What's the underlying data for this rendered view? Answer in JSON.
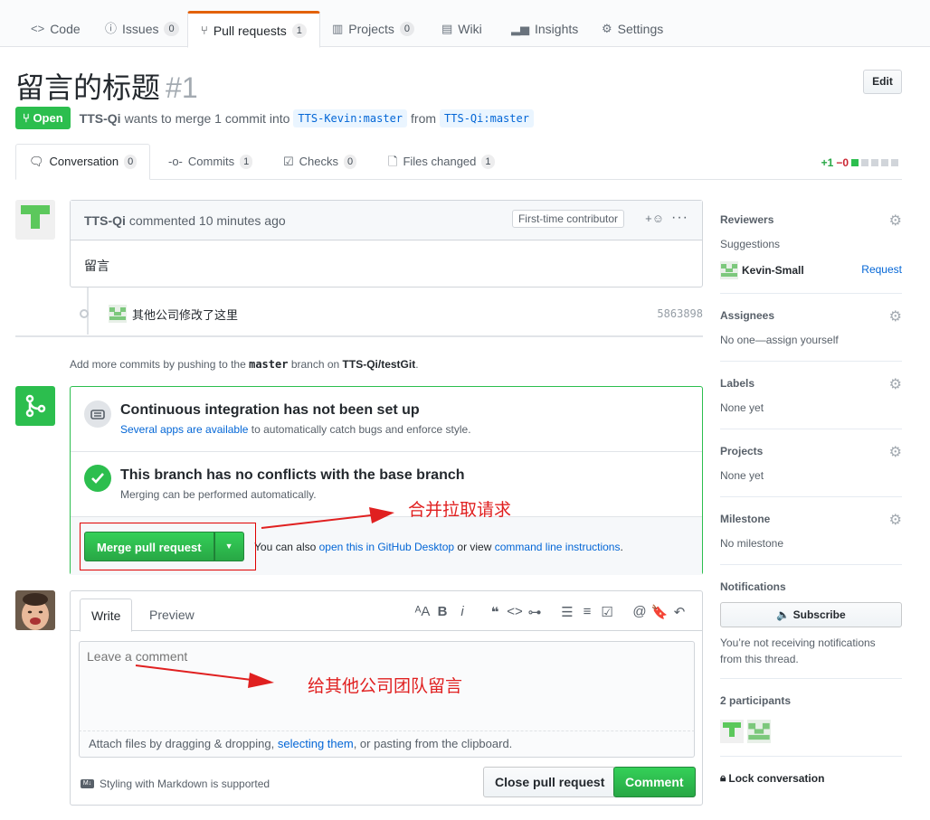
{
  "repo_tabs": [
    {
      "label": "Code",
      "icon": "code-icon"
    },
    {
      "label": "Issues",
      "count": "0",
      "icon": "issue-icon"
    },
    {
      "label": "Pull requests",
      "count": "1",
      "icon": "pull-request-icon"
    },
    {
      "label": "Projects",
      "count": "0",
      "icon": "project-icon"
    },
    {
      "label": "Wiki",
      "icon": "book-icon"
    },
    {
      "label": "Insights",
      "icon": "graph-icon"
    },
    {
      "label": "Settings",
      "icon": "gear-icon"
    }
  ],
  "pr": {
    "title": "留言的标题",
    "number": "#1",
    "edit_label": "Edit",
    "state": "Open",
    "author": "TTS-Qi",
    "merge_text": "wants to merge 1 commit into",
    "base_branch": "TTS-Kevin:master",
    "from_text": "from",
    "head_branch": "TTS-Qi:master"
  },
  "pr_tabs": [
    {
      "label": "Conversation",
      "count": "0",
      "icon": "comment-discussion-icon"
    },
    {
      "label": "Commits",
      "count": "1",
      "icon": "commit-icon"
    },
    {
      "label": "Checks",
      "count": "0",
      "icon": "checklist-icon"
    },
    {
      "label": "Files changed",
      "count": "1",
      "icon": "file-diff-icon"
    }
  ],
  "diffstat": {
    "added": "+1",
    "deleted": "−0"
  },
  "comment": {
    "author": "TTS-Qi",
    "action": "commented 10 minutes ago",
    "badge": "First-time contributor",
    "body": "留言"
  },
  "commit": {
    "message": "其他公司修改了这里",
    "sha": "5863898"
  },
  "push_hint": {
    "prefix": "Add more commits by pushing to the",
    "branch": "master",
    "middle": "branch on",
    "repo": "TTS-Qi/testGit",
    "suffix": "."
  },
  "merge_box": {
    "ci_title": "Continuous integration has not been set up",
    "ci_link": "Several apps are available",
    "ci_rest": "to automatically catch bugs and enforce style.",
    "conflict_title": "This branch has no conflicts with the base branch",
    "conflict_sub": "Merging can be performed automatically.",
    "merge_button": "Merge pull request",
    "also_prefix": "You can also",
    "also_link1": "open this in GitHub Desktop",
    "also_mid": "or view",
    "also_link2": "command line instructions",
    "also_suffix": "."
  },
  "annotations": {
    "merge_note": "合并拉取请求",
    "comment_note": "给其他公司团队留言"
  },
  "new_comment": {
    "tab_write": "Write",
    "tab_preview": "Preview",
    "placeholder": "Leave a comment",
    "attach_prefix": "Attach files by dragging & dropping,",
    "attach_link": "selecting them",
    "attach_suffix": ", or pasting from the clipboard.",
    "markdown_note": "Styling with Markdown is supported",
    "close_button": "Close pull request",
    "comment_button": "Comment"
  },
  "sidebar": {
    "reviewers": {
      "heading": "Reviewers",
      "suggestions": "Suggestions",
      "user": "Kevin-Small",
      "request": "Request"
    },
    "assignees": {
      "heading": "Assignees",
      "value": "No one—assign yourself"
    },
    "labels": {
      "heading": "Labels",
      "value": "None yet"
    },
    "projects": {
      "heading": "Projects",
      "value": "None yet"
    },
    "milestone": {
      "heading": "Milestone",
      "value": "No milestone"
    },
    "notifications": {
      "heading": "Notifications",
      "button": "Subscribe",
      "note": "You’re not receiving notifications from this thread."
    },
    "participants": {
      "heading": "2 participants"
    },
    "lock": "Lock conversation"
  },
  "colors": {
    "accent": "#2cbe4e",
    "link": "#0366d6",
    "tab_highlight": "#e36209",
    "annotation": "#e02020"
  }
}
